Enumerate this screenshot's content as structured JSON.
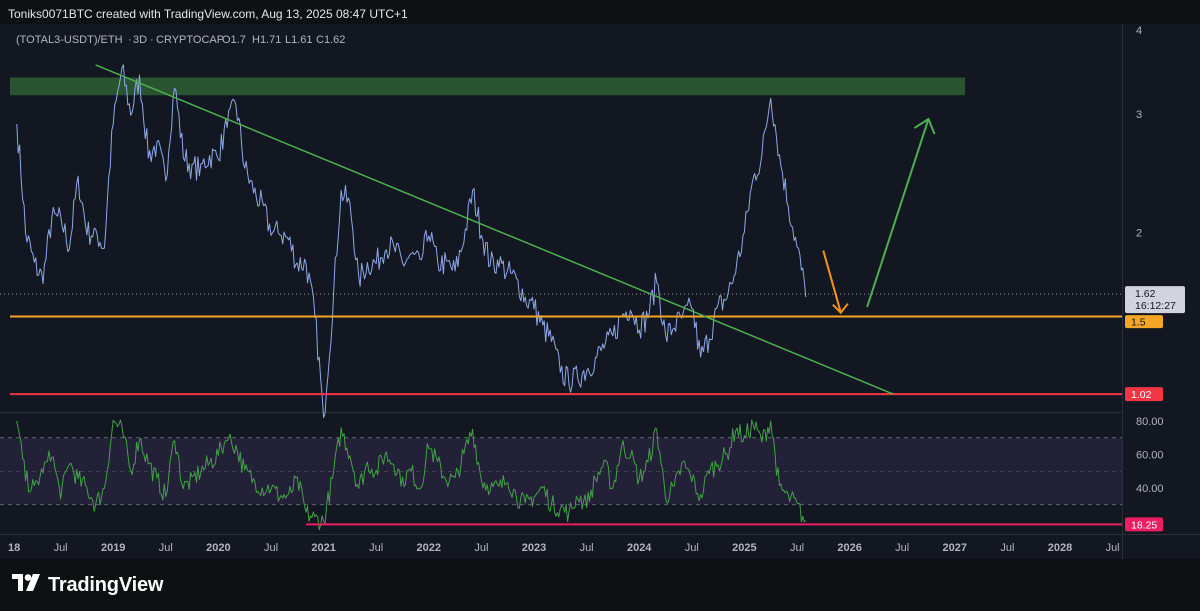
{
  "header": {
    "credit": "Toniks0071BTC created with TradingView.com, Aug 13, 2025 08:47 UTC+1"
  },
  "brand": {
    "name": "TradingView",
    "icon": "tradingview-logo-icon"
  },
  "colors": {
    "background": "#131722",
    "price_line": "#8ea8e6",
    "rsi_line": "#43a047",
    "rsi_band": "#2a2540",
    "support_orange": "#f5a623",
    "support_red": "#f23645",
    "rsi_low_line": "#e91e63",
    "trendline": "#4caf50",
    "resistance_zone": "#2e5a32",
    "arrow_orange": "#f7931a",
    "arrow_green": "#4caf50"
  },
  "chart_data": [
    {
      "type": "line",
      "legend": {
        "symbol": "(TOTAL3-USDT)/ETH",
        "interval": "3D",
        "exchange": "CRYPTOCAP",
        "open": "O1.7",
        "high": "H1.71",
        "low": "L1.61",
        "close": "C1.62"
      },
      "y_scale": "log",
      "ylim": [
        0.9,
        4.0
      ],
      "yticks": [
        "4",
        "3",
        "2"
      ],
      "x_ticks": [
        "18",
        "Jul",
        "2019",
        "Jul",
        "2020",
        "Jul",
        "2021",
        "Jul",
        "2022",
        "Jul",
        "2023",
        "Jul",
        "2024",
        "Jul",
        "2025",
        "Jul",
        "2026",
        "Jul",
        "2027",
        "Jul",
        "2028",
        "Jul"
      ],
      "series": [
        {
          "x": [
            "2018-02",
            "2018-03",
            "2018-04",
            "2018-05",
            "2018-06",
            "2018-07",
            "2018-08",
            "2018-09",
            "2018-10",
            "2018-11",
            "2018-12",
            "2019-01",
            "2019-02",
            "2019-03",
            "2019-04",
            "2019-05",
            "2019-06",
            "2019-07",
            "2019-08",
            "2019-09",
            "2019-10",
            "2019-11",
            "2019-12",
            "2020-01",
            "2020-02",
            "2020-03",
            "2020-04",
            "2020-05",
            "2020-06",
            "2020-07",
            "2020-08",
            "2020-09",
            "2020-10",
            "2020-11",
            "2020-12",
            "2021-01",
            "2021-02",
            "2021-03",
            "2021-04",
            "2021-05",
            "2021-06",
            "2021-07",
            "2021-08",
            "2021-09",
            "2021-10",
            "2021-11",
            "2021-12",
            "2022-01",
            "2022-02",
            "2022-03",
            "2022-04",
            "2022-05",
            "2022-06",
            "2022-07",
            "2022-08",
            "2022-09",
            "2022-10",
            "2022-11",
            "2022-12",
            "2023-01",
            "2023-02",
            "2023-03",
            "2023-04",
            "2023-05",
            "2023-06",
            "2023-07",
            "2023-08",
            "2023-09",
            "2023-10",
            "2023-11",
            "2023-12",
            "2024-01",
            "2024-02",
            "2024-03",
            "2024-04",
            "2024-05",
            "2024-06",
            "2024-07",
            "2024-08",
            "2024-09",
            "2024-10",
            "2024-11",
            "2024-12",
            "2025-01",
            "2025-02",
            "2025-03",
            "2025-04",
            "2025-05",
            "2025-06",
            "2025-07",
            "2025-08"
          ],
          "values": [
            2.9,
            2.0,
            1.8,
            1.7,
            2.1,
            2.1,
            1.9,
            2.4,
            2.0,
            2.0,
            1.9,
            2.9,
            3.5,
            3.0,
            3.4,
            2.6,
            2.7,
            2.4,
            3.3,
            2.6,
            2.5,
            2.5,
            2.6,
            2.6,
            2.9,
            3.1,
            2.5,
            2.3,
            2.2,
            2.0,
            2.0,
            1.95,
            1.8,
            1.8,
            1.5,
            1.05,
            1.5,
            2.3,
            2.2,
            1.7,
            1.8,
            1.8,
            1.9,
            1.9,
            1.8,
            1.85,
            1.8,
            2.0,
            1.8,
            1.8,
            1.75,
            1.95,
            2.3,
            2.0,
            1.8,
            1.8,
            1.75,
            1.7,
            1.6,
            1.55,
            1.45,
            1.38,
            1.25,
            1.2,
            1.22,
            1.25,
            1.3,
            1.35,
            1.4,
            1.5,
            1.55,
            1.45,
            1.5,
            1.7,
            1.4,
            1.45,
            1.5,
            1.55,
            1.3,
            1.4,
            1.55,
            1.6,
            1.75,
            2.0,
            2.4,
            2.6,
            3.2,
            2.6,
            2.2,
            1.9,
            1.62
          ]
        }
      ],
      "annotations": {
        "price_tag": "1.62",
        "countdown": "16:12:27",
        "orange_level": "1.5",
        "red_level": "1.02",
        "resistance_zone": [
          3.2,
          3.4
        ]
      }
    },
    {
      "type": "line",
      "ylim": [
        15,
        90
      ],
      "yticks": [
        "80.00",
        "60.00",
        "40.00"
      ],
      "series": [
        {
          "x": [
            "2018-02",
            "2018-03",
            "2018-04",
            "2018-05",
            "2018-06",
            "2018-07",
            "2018-08",
            "2018-09",
            "2018-10",
            "2018-11",
            "2018-12",
            "2019-01",
            "2019-02",
            "2019-03",
            "2019-04",
            "2019-05",
            "2019-06",
            "2019-07",
            "2019-08",
            "2019-09",
            "2019-10",
            "2019-11",
            "2019-12",
            "2020-01",
            "2020-02",
            "2020-03",
            "2020-04",
            "2020-05",
            "2020-06",
            "2020-07",
            "2020-08",
            "2020-09",
            "2020-10",
            "2020-11",
            "2020-12",
            "2021-01",
            "2021-02",
            "2021-03",
            "2021-04",
            "2021-05",
            "2021-06",
            "2021-07",
            "2021-08",
            "2021-09",
            "2021-10",
            "2021-11",
            "2021-12",
            "2022-01",
            "2022-02",
            "2022-03",
            "2022-04",
            "2022-05",
            "2022-06",
            "2022-07",
            "2022-08",
            "2022-09",
            "2022-10",
            "2022-11",
            "2022-12",
            "2023-01",
            "2023-02",
            "2023-03",
            "2023-04",
            "2023-05",
            "2023-06",
            "2023-07",
            "2023-08",
            "2023-09",
            "2023-10",
            "2023-11",
            "2023-12",
            "2024-01",
            "2024-02",
            "2024-03",
            "2024-04",
            "2024-05",
            "2024-06",
            "2024-07",
            "2024-08",
            "2024-09",
            "2024-10",
            "2024-11",
            "2024-12",
            "2025-01",
            "2025-02",
            "2025-03",
            "2025-04",
            "2025-05",
            "2025-06",
            "2025-07",
            "2025-08"
          ],
          "values": [
            80,
            45,
            40,
            50,
            60,
            35,
            55,
            45,
            40,
            30,
            40,
            80,
            75,
            50,
            70,
            55,
            45,
            35,
            70,
            40,
            45,
            50,
            55,
            60,
            70,
            65,
            50,
            45,
            40,
            40,
            35,
            35,
            45,
            25,
            22,
            20,
            45,
            75,
            60,
            40,
            55,
            50,
            60,
            55,
            45,
            50,
            40,
            65,
            55,
            45,
            45,
            60,
            75,
            45,
            40,
            40,
            45,
            35,
            30,
            35,
            40,
            30,
            28,
            25,
            35,
            30,
            45,
            55,
            40,
            65,
            60,
            45,
            55,
            75,
            35,
            40,
            55,
            45,
            35,
            50,
            55,
            60,
            75,
            70,
            78,
            68,
            80,
            40,
            35,
            30,
            19
          ]
        }
      ],
      "annotations": {
        "low_level": "18.25"
      }
    }
  ]
}
